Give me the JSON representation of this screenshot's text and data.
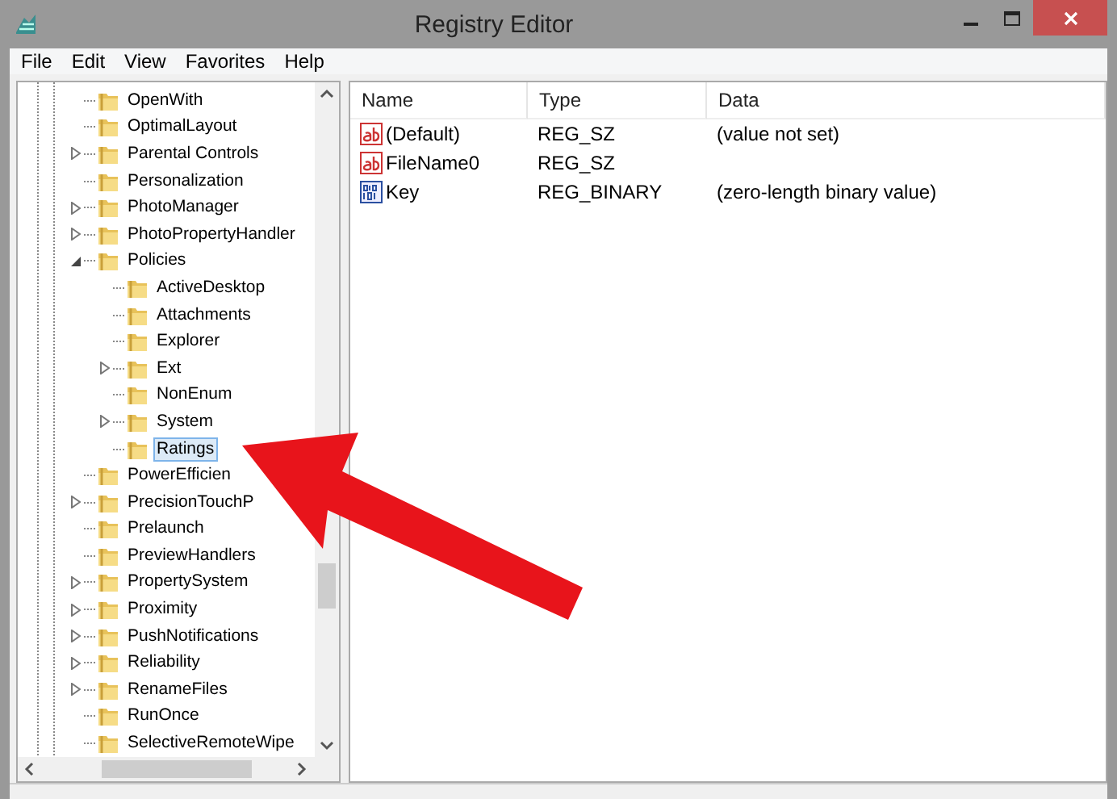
{
  "window": {
    "title": "Registry Editor"
  },
  "menu": [
    "File",
    "Edit",
    "View",
    "Favorites",
    "Help"
  ],
  "tree": {
    "items": [
      {
        "label": "OpenWith",
        "kind": "leaf",
        "selected": false
      },
      {
        "label": "OptimalLayout",
        "kind": "leaf",
        "selected": false
      },
      {
        "label": "Parental Controls",
        "kind": "branch",
        "expanded": false,
        "selected": false
      },
      {
        "label": "Personalization",
        "kind": "leaf",
        "selected": false
      },
      {
        "label": "PhotoManager",
        "kind": "branch",
        "expanded": false,
        "selected": false
      },
      {
        "label": "PhotoPropertyHandler",
        "kind": "branch",
        "expanded": false,
        "selected": false
      },
      {
        "label": "Policies",
        "kind": "branch",
        "expanded": true,
        "selected": false,
        "children": [
          {
            "label": "ActiveDesktop",
            "kind": "leaf",
            "selected": false
          },
          {
            "label": "Attachments",
            "kind": "leaf",
            "selected": false
          },
          {
            "label": "Explorer",
            "kind": "leaf",
            "selected": false
          },
          {
            "label": "Ext",
            "kind": "branch",
            "expanded": false,
            "selected": false
          },
          {
            "label": "NonEnum",
            "kind": "leaf",
            "selected": false
          },
          {
            "label": "System",
            "kind": "branch",
            "expanded": false,
            "selected": false
          },
          {
            "label": "Ratings",
            "kind": "leaf",
            "selected": true
          }
        ]
      },
      {
        "label": "PowerEfficien",
        "kind": "leaf",
        "selected": false
      },
      {
        "label": "PrecisionTouchP",
        "kind": "branch",
        "expanded": false,
        "selected": false
      },
      {
        "label": "Prelaunch",
        "kind": "leaf",
        "selected": false
      },
      {
        "label": "PreviewHandlers",
        "kind": "leaf",
        "selected": false
      },
      {
        "label": "PropertySystem",
        "kind": "branch",
        "expanded": false,
        "selected": false
      },
      {
        "label": "Proximity",
        "kind": "branch",
        "expanded": false,
        "selected": false
      },
      {
        "label": "PushNotifications",
        "kind": "branch",
        "expanded": false,
        "selected": false
      },
      {
        "label": "Reliability",
        "kind": "branch",
        "expanded": false,
        "selected": false
      },
      {
        "label": "RenameFiles",
        "kind": "branch",
        "expanded": false,
        "selected": false
      },
      {
        "label": "RunOnce",
        "kind": "leaf",
        "selected": false
      },
      {
        "label": "SelectiveRemoteWipe",
        "kind": "leaf",
        "selected": false
      }
    ]
  },
  "values": {
    "columns": [
      "Name",
      "Type",
      "Data"
    ],
    "rows": [
      {
        "kind": "string",
        "name": "(Default)",
        "type": "REG_SZ",
        "data": "(value not set)"
      },
      {
        "kind": "string",
        "name": "FileName0",
        "type": "REG_SZ"
      },
      {
        "kind": "binary",
        "name": "Key",
        "type": "REG_BINARY",
        "data": "(zero-length binary value)"
      }
    ]
  }
}
